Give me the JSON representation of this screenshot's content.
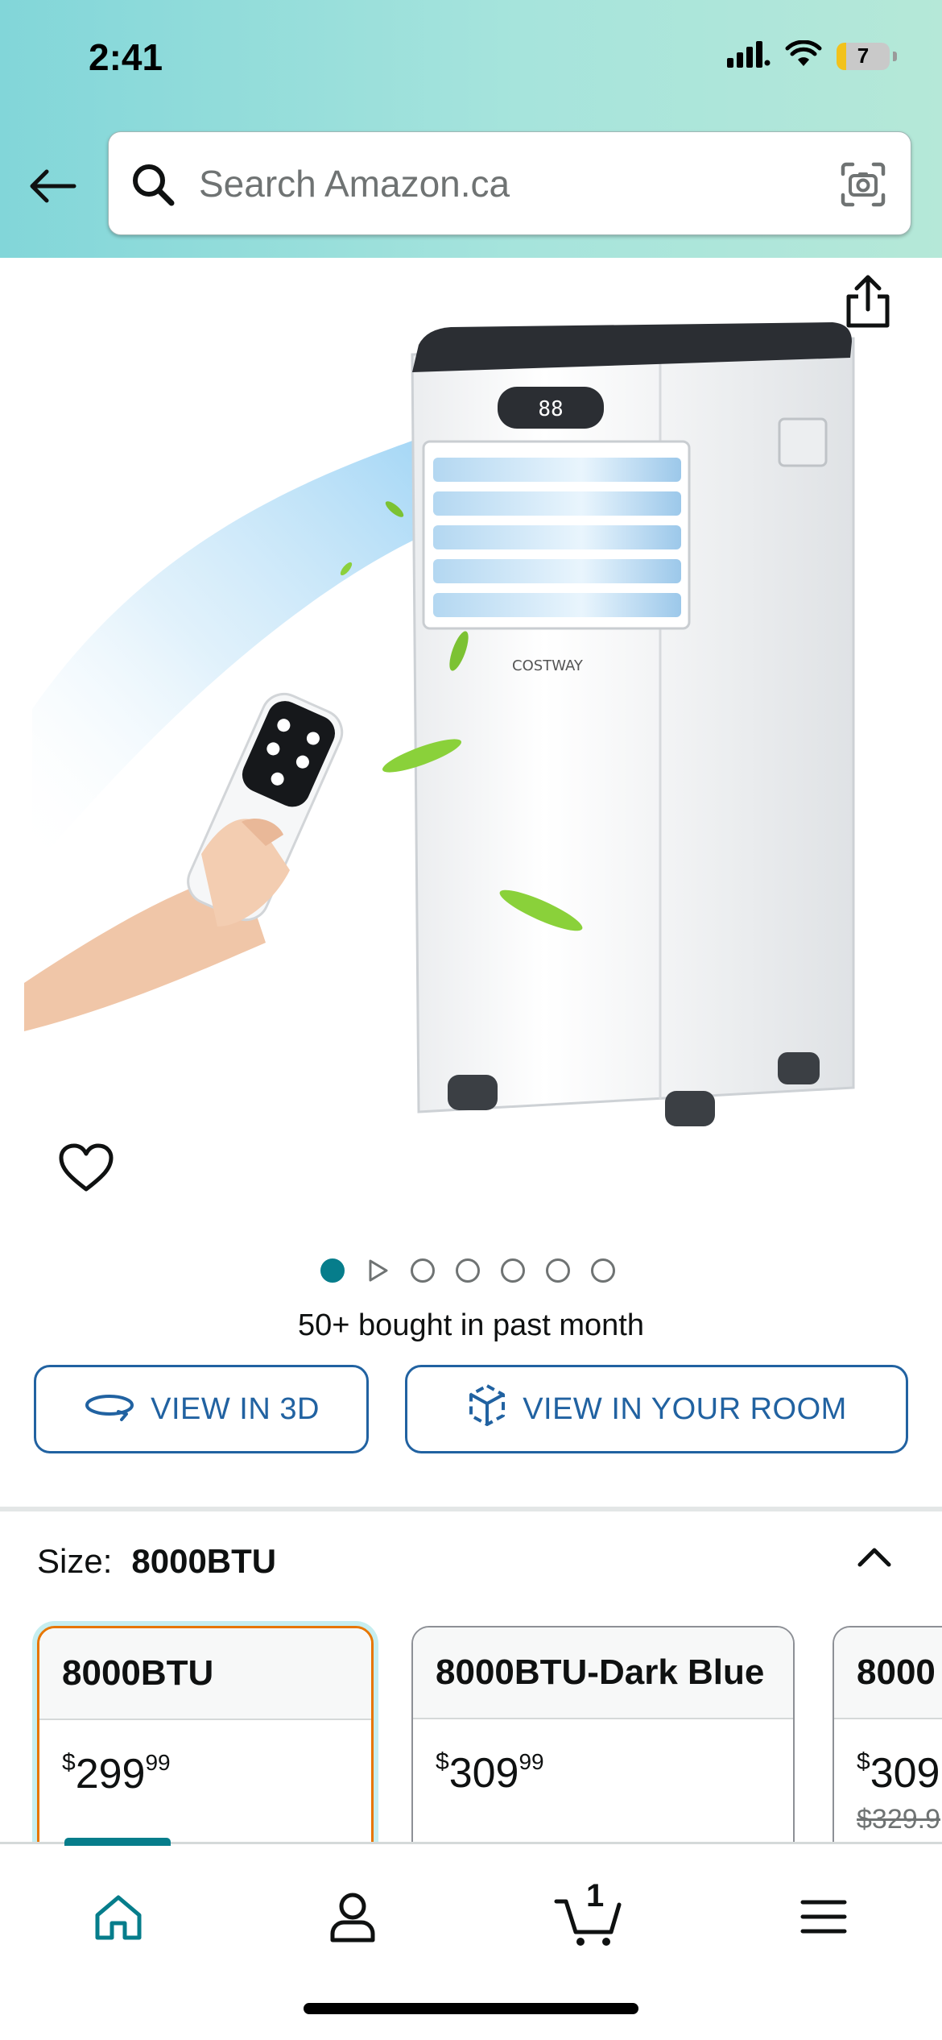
{
  "status_bar": {
    "time": "2:41",
    "battery_level": "7"
  },
  "search": {
    "placeholder": "Search Amazon.ca"
  },
  "product": {
    "image_alt": "COSTWAY portable air conditioner with remote",
    "brand_text": "COSTWAY",
    "display_text": "88",
    "gallery": {
      "total_dots": 7,
      "active_index": 0,
      "video_index": 1
    },
    "bought_text": "50+ bought in past month"
  },
  "actions": {
    "view_3d_label": "VIEW IN 3D",
    "view_room_label": "VIEW IN YOUR ROOM"
  },
  "size": {
    "label": "Size:",
    "selected": "8000BTU",
    "options": [
      {
        "name": "8000BTU",
        "price_currency": "$",
        "price_whole": "299",
        "price_fraction": "99",
        "old_price": ""
      },
      {
        "name": "8000BTU-Dark Blue",
        "price_currency": "$",
        "price_whole": "309",
        "price_fraction": "99",
        "old_price": ""
      },
      {
        "name": "8000",
        "price_currency": "$",
        "price_whole": "309",
        "price_fraction": "",
        "old_price": "$329.9"
      }
    ]
  },
  "nav": {
    "cart_count": "1"
  },
  "colors": {
    "accent_teal": "#067d8b",
    "link_blue": "#2162a1",
    "selected_orange": "#e77600"
  }
}
